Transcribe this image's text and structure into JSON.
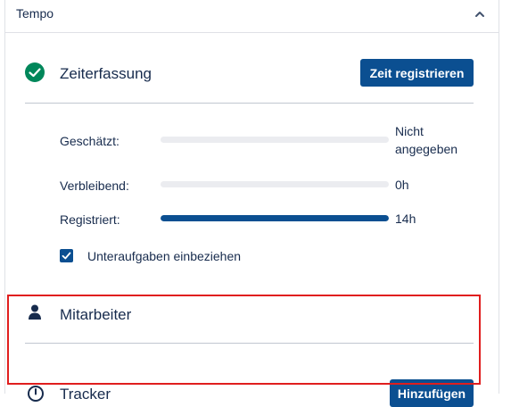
{
  "panel": {
    "title": "Tempo",
    "collapse_icon": "chevron-up-icon"
  },
  "time_tracking": {
    "title": "Zeiterfassung",
    "status_icon": "check-circle-icon",
    "status_color": "#00875a",
    "button_label": "Zeit registrieren",
    "rows": [
      {
        "label": "Geschätzt:",
        "value": "Nicht angegeben",
        "progress": 0
      },
      {
        "label": "Verbleibend:",
        "value": "0h",
        "progress": 0
      },
      {
        "label": "Registriert:",
        "value": "14h",
        "progress": 1.0
      }
    ],
    "include_subtasks": {
      "label": "Unteraufgaben einbeziehen",
      "checked": true
    }
  },
  "staff": {
    "title": "Mitarbeiter",
    "icon": "person-icon"
  },
  "tracker": {
    "title": "Tracker",
    "icon": "clock-icon",
    "button_label": "Hinzufügen"
  },
  "colors": {
    "accent": "#0b4f91",
    "highlight": "#e01e1e"
  }
}
